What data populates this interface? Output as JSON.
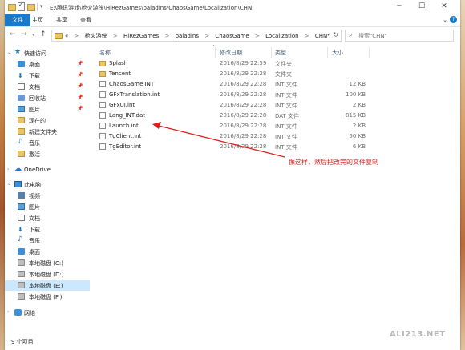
{
  "window": {
    "title_path": "E:\\腾讯游戏\\枪火游侠\\HiRezGames\\paladins\\ChaosGame\\Localization\\CHN"
  },
  "ribbon": {
    "tabs": [
      "文件",
      "主页",
      "共享",
      "查看"
    ],
    "active_tab": "文件",
    "accent": "#1979ca"
  },
  "address": {
    "prefix": "«",
    "crumbs": [
      "枪火游侠",
      "HiRezGames",
      "paladins",
      "ChaosGame",
      "Localization",
      "CHN"
    ],
    "separator": ">"
  },
  "search": {
    "placeholder": "搜索\"CHN\""
  },
  "nav": {
    "quick_access": "快速访问",
    "quick_items": [
      "桌面",
      "下载",
      "文档",
      "回收站",
      "图片",
      "现在的",
      "新建文件夹",
      "音乐",
      "激活"
    ],
    "onedrive": "OneDrive",
    "this_pc": "此电脑",
    "pc_items": [
      "视频",
      "图片",
      "文档",
      "下载",
      "音乐",
      "桌面",
      "本地磁盘 (C:)",
      "本地磁盘 (D:)",
      "本地磁盘 (E:)",
      "本地磁盘 (F:)"
    ],
    "selected": "本地磁盘 (E:)",
    "network": "网络"
  },
  "columns": {
    "name": "名称",
    "date": "修改日期",
    "type": "类型",
    "size": "大小"
  },
  "files": [
    {
      "name": "Splash",
      "date": "2016/8/29 22:59",
      "type": "文件夹",
      "size": "",
      "kind": "folder"
    },
    {
      "name": "Tencent",
      "date": "2016/8/29 22:28",
      "type": "文件夹",
      "size": "",
      "kind": "folder"
    },
    {
      "name": "ChaosGame.INT",
      "date": "2016/8/29 22:28",
      "type": "INT 文件",
      "size": "12 KB",
      "kind": "file"
    },
    {
      "name": "GFxTranslation.int",
      "date": "2016/8/29 22:28",
      "type": "INT 文件",
      "size": "100 KB",
      "kind": "file"
    },
    {
      "name": "GFxUI.int",
      "date": "2016/8/29 22:28",
      "type": "INT 文件",
      "size": "2 KB",
      "kind": "file"
    },
    {
      "name": "Lang_INT.dat",
      "date": "2016/8/29 22:28",
      "type": "DAT 文件",
      "size": "815 KB",
      "kind": "file"
    },
    {
      "name": "Launch.int",
      "date": "2016/8/29 22:28",
      "type": "INT 文件",
      "size": "2 KB",
      "kind": "file"
    },
    {
      "name": "TgClient.int",
      "date": "2016/8/29 22:28",
      "type": "INT 文件",
      "size": "50 KB",
      "kind": "file"
    },
    {
      "name": "TgEditor.int",
      "date": "2016/8/29 22:28",
      "type": "INT 文件",
      "size": "6 KB",
      "kind": "file"
    }
  ],
  "annotation": {
    "text": "像这样，然后把改完的文件复制",
    "color": "#e02020"
  },
  "status": {
    "item_count": "9 个项目"
  },
  "watermark": "ALI213.NET"
}
